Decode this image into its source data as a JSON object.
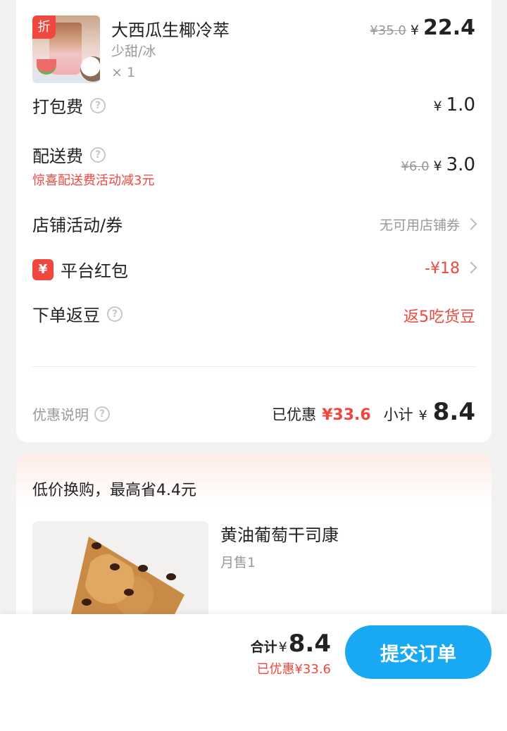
{
  "product": {
    "discount_tag": "折",
    "name": "大西瓜生椰冷萃",
    "spec": "少甜/冰",
    "quantity": "× 1",
    "original_price": "¥35.0",
    "currency": "¥",
    "price": "22.4"
  },
  "fees": {
    "packing_label": "打包费",
    "packing_currency": "¥",
    "packing_value": "1.0",
    "delivery_label": "配送费",
    "delivery_original": "¥6.0",
    "delivery_currency": "¥",
    "delivery_value": "3.0",
    "delivery_promo": "惊喜配送费活动减3元"
  },
  "coupons": {
    "store_label": "店铺活动/券",
    "store_value": "无可用店铺券",
    "platform_icon": "¥",
    "platform_label": "平台红包",
    "platform_value": "-¥18",
    "beans_label": "下单返豆",
    "beans_value": "返5吃货豆"
  },
  "summary": {
    "discount_note": "优惠说明",
    "saved_label": "已优惠",
    "saved_value": "¥33.6",
    "subtotal_label": "小计",
    "subtotal_currency": "¥",
    "subtotal_value": "8.4"
  },
  "deal": {
    "title": "低价换购，最高省4.4元",
    "item_name": "黄油葡萄干司康",
    "item_sold": "月售1"
  },
  "bottom": {
    "total_label": "合计",
    "total_currency": "¥",
    "total_value": "8.4",
    "saved_text": "已优惠¥33.6",
    "submit_label": "提交订单"
  },
  "colors": {
    "accent_red": "#f0483e",
    "submit_blue": "#19a9f2"
  }
}
